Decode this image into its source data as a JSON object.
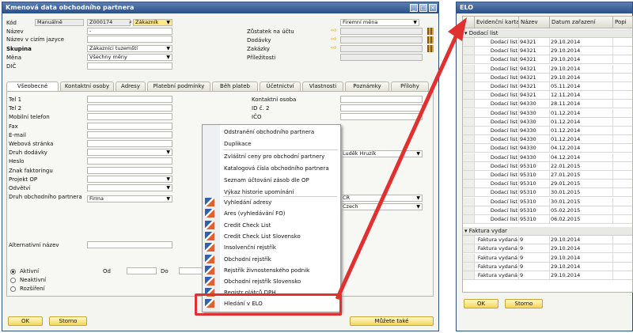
{
  "partner_window": {
    "title": "Kmenová data obchodního partnera",
    "fields_left": [
      {
        "label": "Kód",
        "value": "Manuálně"
      },
      {
        "label": "Název",
        "value": "-"
      },
      {
        "label": "Název v cizím jazyce",
        "value": ""
      },
      {
        "label": "Skupina",
        "value": "Zákazníci tuzemští"
      },
      {
        "label": "Měna",
        "value": "Všechny měny"
      },
      {
        "label": "DIČ",
        "value": ""
      }
    ],
    "code_value": "Z000174",
    "type_value": "Zákazník",
    "fields_right": [
      {
        "label": "Zůstatek na účtu"
      },
      {
        "label": "Dodávky"
      },
      {
        "label": "Zakázky"
      },
      {
        "label": "Příležitosti"
      }
    ],
    "currency_value": "Firemní měna",
    "tabs": [
      "Všeobecné",
      "Kontaktní osoby",
      "Adresy",
      "Platební podmínky",
      "Běh plateb",
      "Účetnictví",
      "Vlastnosti",
      "Poznámky",
      "Přílohy"
    ],
    "general_left": [
      "Tel 1",
      "Tel 2",
      "Mobilní telefon",
      "Fax",
      "E-mail",
      "Webová stránka",
      "Druh dodávky",
      "Heslo",
      "Znak faktoringu",
      "Projekt OP",
      "Odvětví",
      "Druh obchodního partnera"
    ],
    "partner_kind_value": "Firma",
    "general_right": [
      "Kontaktní osoba",
      "ID č. 2",
      "IČO"
    ],
    "sales_person_value": "Luděk Hruzík",
    "country_value": "ČR",
    "language_value": "Czech",
    "alt_name_label": "Alternativní název",
    "radios": [
      "Aktivní",
      "Neaktivní",
      "Rozšíření"
    ],
    "from_label": "Od",
    "to_label": "Do",
    "ok_label": "OK",
    "cancel_label": "Storno",
    "more_label": "Můžete také"
  },
  "context_menu": {
    "items": [
      "Odstranění obchodního partnera",
      "Duplikace",
      "Zvláštní ceny pro obchodní partnery",
      "Katalogová čísla obchodního partnera",
      "Seznam účtování zásob dle OP",
      "Výkaz historie upomínání",
      "Vyhledání adresy",
      "Ares (vyhledávání FO)",
      "Credit Check List",
      "Credit Check List Slovensko",
      "Insolvenční rejstřík",
      "Obchodní rejstřík",
      "Rejstřík živnostenského podnik",
      "Obchodní rejstřík Slovensko",
      "Registr plátců DPH",
      "Hledání v ELO"
    ]
  },
  "elo_window": {
    "title": "ELO",
    "columns": [
      "Evidenční karta",
      "Název",
      "Datum zařazení",
      "Popi"
    ],
    "group1": "Dodací list",
    "rows1": [
      [
        "Dodací list",
        "94321",
        "29.10.2014"
      ],
      [
        "Dodací list",
        "94321",
        "29.10.2014"
      ],
      [
        "Dodací list",
        "94321",
        "29.10.2014"
      ],
      [
        "Dodací list",
        "94321",
        "29.10.2014"
      ],
      [
        "Dodací list",
        "94321",
        "29.10.2014"
      ],
      [
        "Dodací list",
        "94321",
        "05.11.2014"
      ],
      [
        "Dodací list",
        "94321",
        "12.11.2014"
      ],
      [
        "Dodací list",
        "94330",
        "28.11.2014"
      ],
      [
        "Dodací list",
        "94330",
        "01.12.2014"
      ],
      [
        "Dodací list",
        "94330",
        "01.12.2014"
      ],
      [
        "Dodací list",
        "94330",
        "01.12.2014"
      ],
      [
        "Dodací list",
        "94330",
        "01.12.2014"
      ],
      [
        "Dodací list",
        "94330",
        "04.12.2014"
      ],
      [
        "Dodací list",
        "94330",
        "04.12.2014"
      ],
      [
        "Dodací list",
        "95310",
        "22.01.2015"
      ],
      [
        "Dodací list",
        "95310",
        "27.01.2015"
      ],
      [
        "Dodací list",
        "95310",
        "29.01.2015"
      ],
      [
        "Dodací list",
        "95310",
        "30.01.2015"
      ],
      [
        "Dodací list",
        "95310",
        "30.01.2015"
      ],
      [
        "Dodací list",
        "95310",
        "05.02.2015"
      ],
      [
        "Dodací list",
        "95310",
        "06.02.2015"
      ]
    ],
    "group2": "Faktura vydar",
    "rows2": [
      [
        "Faktura vydaná",
        "9",
        "29.10.2014"
      ],
      [
        "Faktura vydaná",
        "9",
        "29.10.2014"
      ],
      [
        "Faktura vydaná",
        "9",
        "29.10.2014"
      ],
      [
        "Faktura vydaná",
        "9",
        "29.10.2014"
      ],
      [
        "Faktura vydaná",
        "9",
        "29.10.2014"
      ]
    ],
    "ok_label": "OK",
    "cancel_label": "Storno"
  },
  "colors": {
    "accent": "#e03030",
    "title_bar": "#2b4f86",
    "yellow_button": "#f3d65c"
  }
}
